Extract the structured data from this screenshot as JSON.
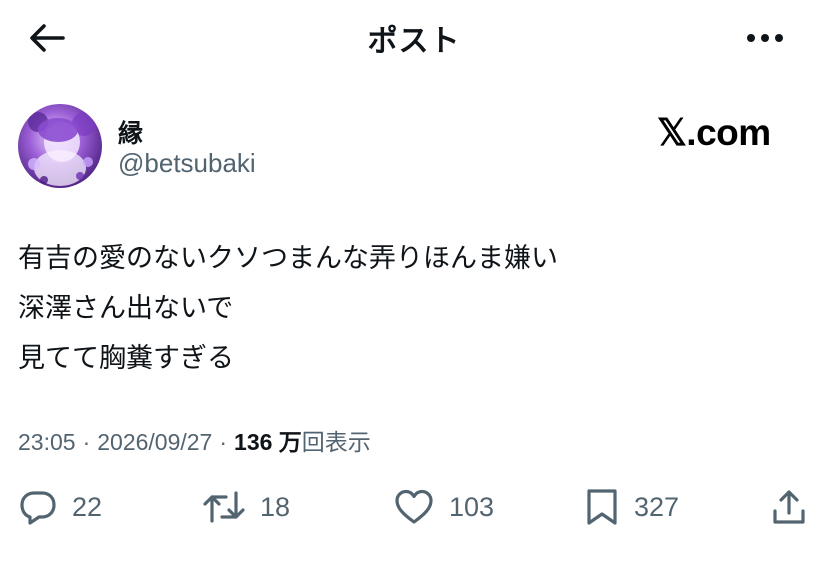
{
  "header": {
    "title": "ポスト",
    "back_icon": "arrow-left-icon",
    "more_icon": "more-horizontal-icon"
  },
  "author": {
    "display_name": "縁",
    "handle": "@betsubaki"
  },
  "watermark": {
    "text": "𝕏.com"
  },
  "tweet": {
    "lines": [
      "有吉の愛のないクソつまんな弄りほんま嫌い",
      "深澤さん出ないで",
      "見てて胸糞すぎる"
    ]
  },
  "meta": {
    "time": "23:05",
    "date": "2026/09/27",
    "separator": "·",
    "views_count": "136 万",
    "views_label": "回表示"
  },
  "actions": {
    "replies": "22",
    "retweets": "18",
    "likes": "103",
    "bookmarks": "327"
  },
  "colors": {
    "text_primary": "#0f1419",
    "text_secondary": "#536471",
    "background": "#ffffff"
  }
}
